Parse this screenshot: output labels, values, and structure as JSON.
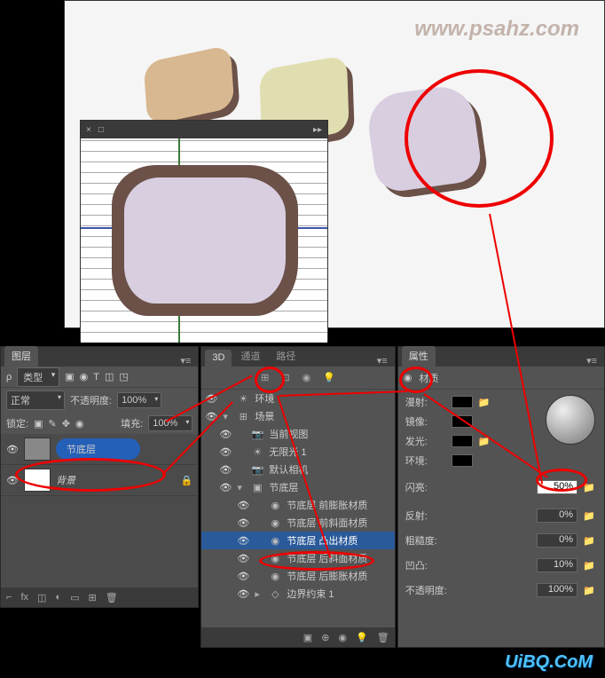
{
  "watermark_top": "www.psahz.com",
  "watermark_bottom": "UiBQ.CoM",
  "mini_panel": {
    "tab1": "×",
    "tab2": "□"
  },
  "layers_panel": {
    "tab": "图层",
    "kind_label": "类型",
    "icons": [
      "▣",
      "◉",
      "T",
      "◫",
      "◳"
    ],
    "blend_mode": "正常",
    "opacity_label": "不透明度:",
    "opacity_value": "100%",
    "lock_label": "锁定:",
    "lock_icons": [
      "▣",
      "✎",
      "✥",
      "◉"
    ],
    "fill_label": "填充:",
    "fill_value": "100%",
    "items": [
      {
        "name": "节底层",
        "selected": true
      },
      {
        "name": "背景",
        "selected": false
      }
    ],
    "footer_icons": [
      "⌐",
      "fx",
      "◫",
      "◐",
      "▭",
      "⊞",
      "🗑"
    ]
  },
  "p3d_panel": {
    "tabs": [
      "3D",
      "通道",
      "路径"
    ],
    "filter_icons": [
      "⊞",
      "⊡",
      "◉",
      "💡"
    ],
    "tree": [
      {
        "icon": "☀",
        "label": "环境",
        "indent": 0,
        "arrow": ""
      },
      {
        "icon": "⊞",
        "label": "场景",
        "indent": 0,
        "arrow": "▾"
      },
      {
        "icon": "📷",
        "label": "当前视图",
        "indent": 1,
        "arrow": ""
      },
      {
        "icon": "☀",
        "label": "无限光 1",
        "indent": 1,
        "arrow": ""
      },
      {
        "icon": "📷",
        "label": "默认相机",
        "indent": 1,
        "arrow": ""
      },
      {
        "icon": "▣",
        "label": "节底层",
        "indent": 1,
        "arrow": "▾"
      },
      {
        "icon": "◉",
        "label": "节底层 前膨胀材质",
        "indent": 2,
        "arrow": ""
      },
      {
        "icon": "◉",
        "label": "节底层 前斜面材质",
        "indent": 2,
        "arrow": ""
      },
      {
        "icon": "◉",
        "label": "节底层 凸出材质",
        "indent": 2,
        "arrow": "",
        "sel": true
      },
      {
        "icon": "◉",
        "label": "节底层 后斜面材质",
        "indent": 2,
        "arrow": ""
      },
      {
        "icon": "◉",
        "label": "节底层 后膨胀材质",
        "indent": 2,
        "arrow": ""
      },
      {
        "icon": "◇",
        "label": "边界约束 1",
        "indent": 2,
        "arrow": "▸"
      }
    ],
    "footer_icons": [
      "▣",
      "⊕",
      "◉",
      "💡",
      "🗑"
    ]
  },
  "props_panel": {
    "tab": "属性",
    "title_icon": "◉",
    "title": "材质",
    "rows_top": [
      {
        "label": "漫射:"
      },
      {
        "label": "镜像:"
      },
      {
        "label": "发光:"
      },
      {
        "label": "环境:"
      }
    ],
    "shine": {
      "label": "闪亮:",
      "value": "50%"
    },
    "reflect": {
      "label": "反射:",
      "value": "0%"
    },
    "rough": {
      "label": "粗糙度:",
      "value": "0%"
    },
    "bump": {
      "label": "凹凸:",
      "value": "10%"
    },
    "opacity": {
      "label": "不透明度:",
      "value": "100%"
    }
  }
}
